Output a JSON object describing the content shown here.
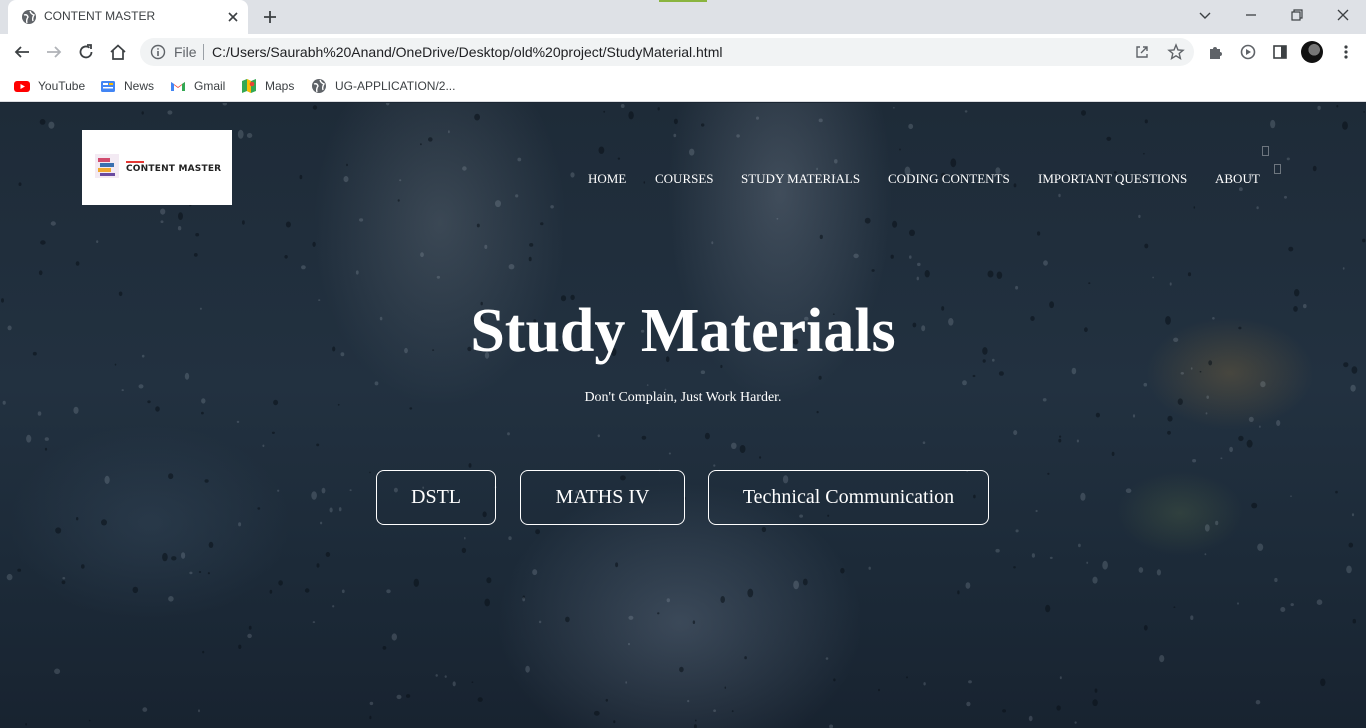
{
  "browser": {
    "tab": {
      "title": "CONTENT MASTER"
    },
    "address": {
      "scheme": "File",
      "url": "C:/Users/Saurabh%20Anand/OneDrive/Desktop/old%20project/StudyMaterial.html"
    },
    "bookmarks": [
      {
        "label": "YouTube",
        "icon": "youtube-icon"
      },
      {
        "label": "News",
        "icon": "news-icon"
      },
      {
        "label": "Gmail",
        "icon": "gmail-icon"
      },
      {
        "label": "Maps",
        "icon": "maps-icon"
      },
      {
        "label": "UG-APPLICATION/2...",
        "icon": "globe-icon"
      }
    ]
  },
  "site": {
    "logo_text": "CONTENT MASTER",
    "nav": [
      "HOME",
      "COURSES",
      "STUDY MATERIALS",
      "CODING CONTENTS",
      "IMPORTANT QUESTIONS",
      "ABOUT"
    ],
    "hero": {
      "title": "Study Materials",
      "subtitle": "Don't Complain, Just Work Harder."
    },
    "subjects": [
      "DSTL",
      "MATHS IV",
      "Technical Communication"
    ]
  },
  "colors": {
    "chrome_tabstrip": "#dee1e6",
    "page_background": "#1e2b38",
    "text_on_page": "#ffffff",
    "logo_accent": "#e53935"
  }
}
